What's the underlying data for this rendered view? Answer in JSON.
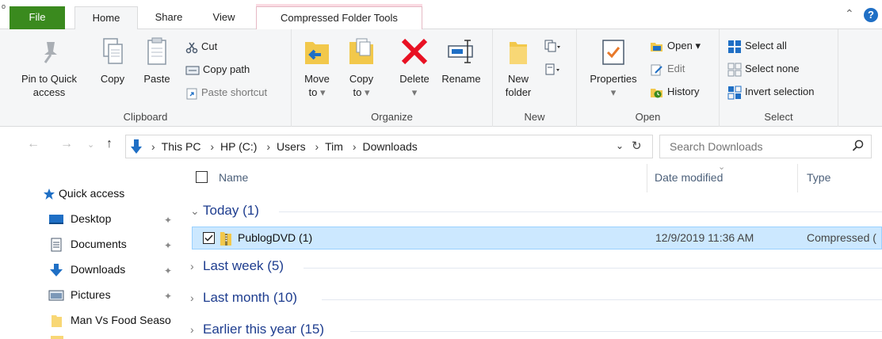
{
  "tabs": {
    "file": "File",
    "home": "Home",
    "share": "Share",
    "view": "View",
    "compressed": "Compressed Folder Tools",
    "corner": "o"
  },
  "ribbon": {
    "clipboard": {
      "label": "Clipboard",
      "pin_line1": "Pin to Quick",
      "pin_line2": "access",
      "copy": "Copy",
      "paste": "Paste",
      "cut": "Cut",
      "copy_path": "Copy path",
      "paste_shortcut": "Paste shortcut"
    },
    "organize": {
      "label": "Organize",
      "move_line1": "Move",
      "move_line2": "to",
      "copy_line1": "Copy",
      "copy_line2": "to",
      "delete": "Delete",
      "rename": "Rename"
    },
    "new": {
      "label": "New",
      "folder_line1": "New",
      "folder_line2": "folder"
    },
    "open": {
      "label": "Open",
      "properties": "Properties",
      "open": "Open",
      "edit": "Edit",
      "history": "History"
    },
    "select": {
      "label": "Select",
      "select_all": "Select all",
      "select_none": "Select none",
      "invert_selection": "Invert selection"
    }
  },
  "address": {
    "crumbs": [
      "This PC",
      "HP (C:)",
      "Users",
      "Tim",
      "Downloads"
    ],
    "search_placeholder": "Search Downloads"
  },
  "nav": {
    "quick_access": "Quick access",
    "items": [
      "Desktop",
      "Documents",
      "Downloads",
      "Pictures",
      "Man Vs Food Seaso"
    ]
  },
  "columns": {
    "name": "Name",
    "date_modified": "Date modified",
    "type": "Type"
  },
  "groups": {
    "today": "Today (1)",
    "last_week": "Last week (5)",
    "last_month": "Last month (10)",
    "earlier_this_year": "Earlier this year (15)"
  },
  "files": [
    {
      "name": "PublogDVD (1)",
      "date": "12/9/2019 11:36 AM",
      "type": "Compressed ("
    }
  ],
  "colors": {
    "file_tab": "#3a8a1e",
    "selection": "#cce8ff",
    "group_text": "#1e3d8f",
    "accent_blue": "#1f6fc5",
    "delete_red": "#e81123"
  }
}
